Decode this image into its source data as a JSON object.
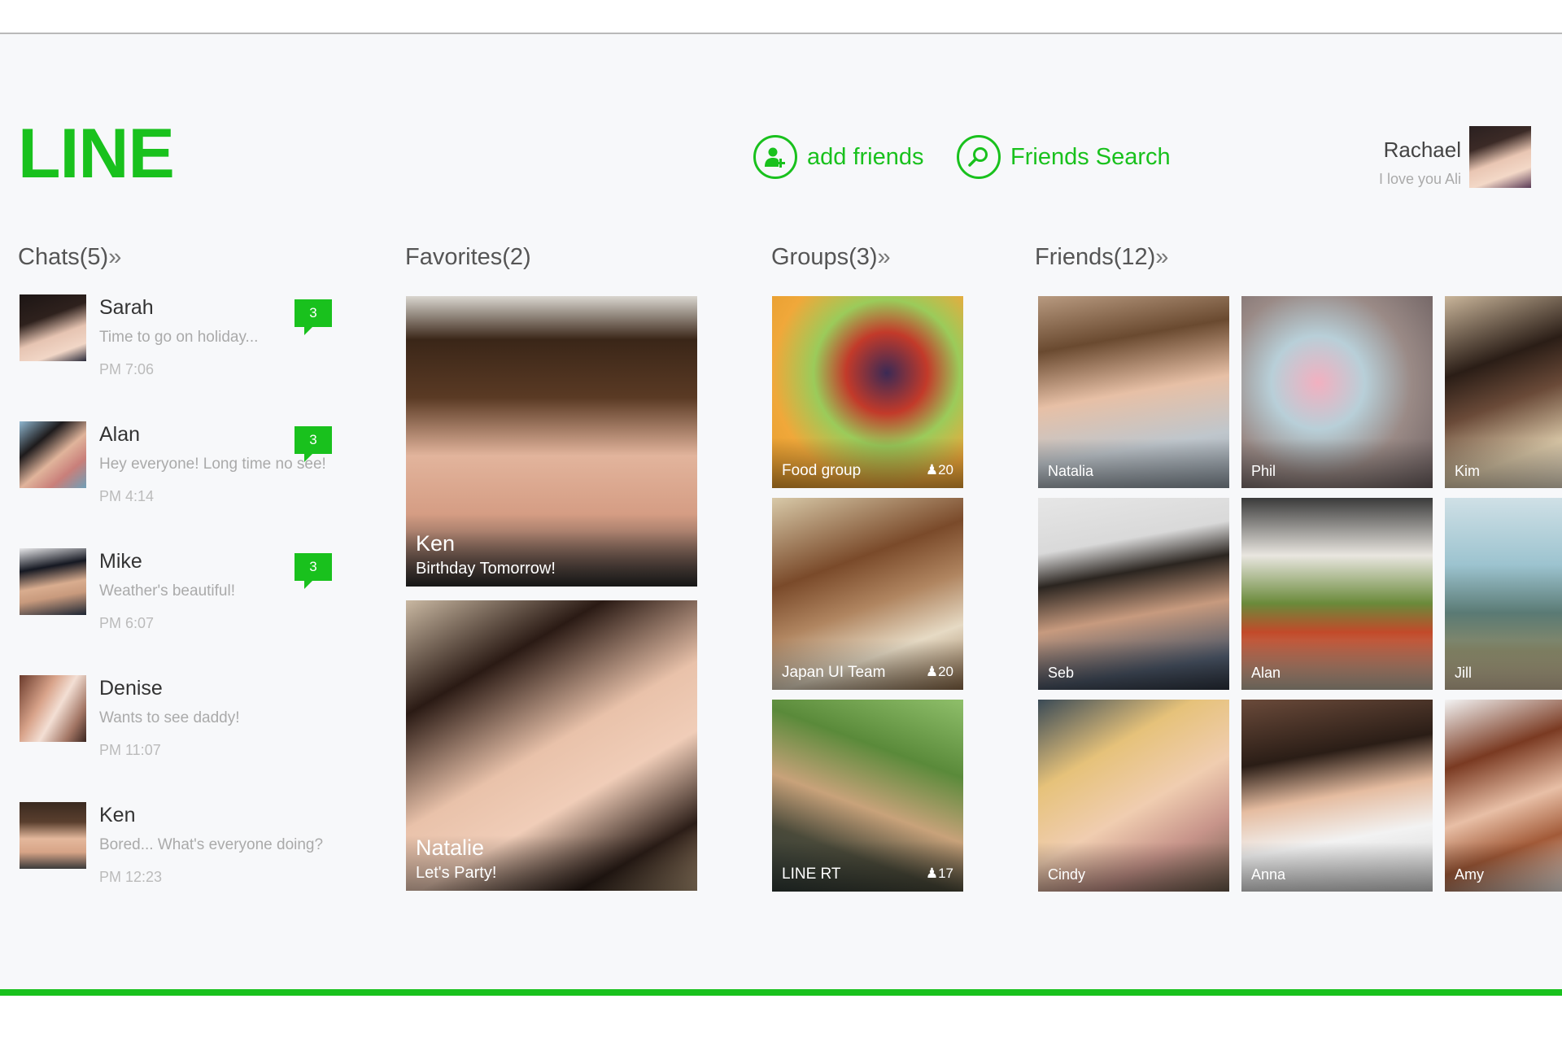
{
  "app": {
    "logo": "LINE"
  },
  "header": {
    "add_friends": "add friends",
    "friends_search": "Friends Search",
    "profile": {
      "name": "Rachael",
      "status": "I love you Ali"
    }
  },
  "sections": {
    "chats": {
      "title": "Chats(5)",
      "chevron": "»"
    },
    "favorites": {
      "title": "Favorites(2)"
    },
    "groups": {
      "title": "Groups(3)",
      "chevron": "»"
    },
    "friends": {
      "title": "Friends(12)",
      "chevron": "»"
    }
  },
  "chats": [
    {
      "name": "Sarah",
      "message": "Time to go on holiday...",
      "time": "PM 7:06",
      "badge": "3"
    },
    {
      "name": "Alan",
      "message": "Hey everyone! Long time no see!",
      "time": "PM 4:14",
      "badge": "3"
    },
    {
      "name": "Mike",
      "message": "Weather's beautiful!",
      "time": "PM 6:07",
      "badge": "3"
    },
    {
      "name": "Denise",
      "message": "Wants to see daddy!",
      "time": "PM 11:07"
    },
    {
      "name": "Ken",
      "message": "Bored... What's everyone doing?",
      "time": "PM 12:23"
    }
  ],
  "favorites": [
    {
      "name": "Ken",
      "status": "Birthday Tomorrow!"
    },
    {
      "name": "Natalie",
      "status": "Let's Party!"
    }
  ],
  "groups": [
    {
      "name": "Food group",
      "members": "20"
    },
    {
      "name": "Japan UI Team",
      "members": "20"
    },
    {
      "name": "LINE RT",
      "members": "17"
    }
  ],
  "friends": [
    {
      "name": "Natalia"
    },
    {
      "name": "Phil"
    },
    {
      "name": "Kim"
    },
    {
      "name": "Seb"
    },
    {
      "name": "Alan"
    },
    {
      "name": "Jill"
    },
    {
      "name": "Cindy"
    },
    {
      "name": "Anna"
    },
    {
      "name": "Amy"
    }
  ],
  "colors": {
    "accent": "#19c11d",
    "background": "#f7f8fa"
  }
}
